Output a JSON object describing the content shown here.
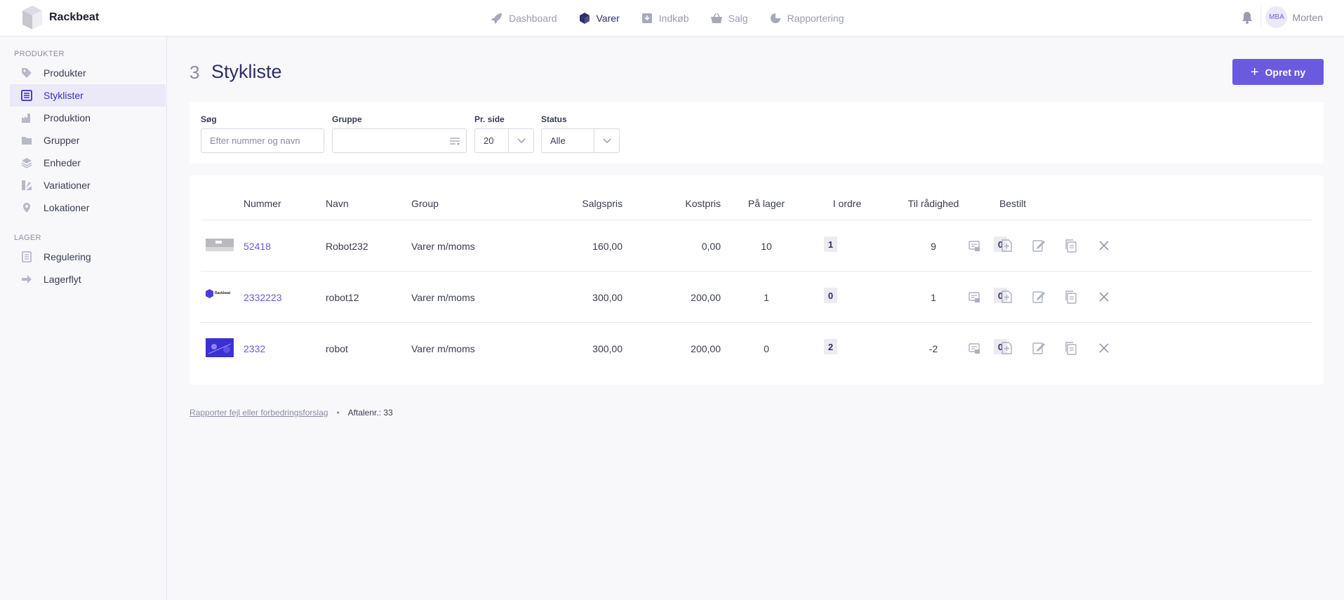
{
  "brand": {
    "name": "Rackbeat"
  },
  "topnav": [
    {
      "label": "Dashboard",
      "icon": "rocket-icon"
    },
    {
      "label": "Varer",
      "icon": "cube-icon"
    },
    {
      "label": "Indkøb",
      "icon": "download-box-icon"
    },
    {
      "label": "Salg",
      "icon": "basket-icon"
    },
    {
      "label": "Rapportering",
      "icon": "pie-chart-icon"
    }
  ],
  "user": {
    "initials": "MBA",
    "name": "Morten"
  },
  "sidebar": {
    "section_products": "PRODUKTER",
    "section_stock": "LAGER",
    "items": [
      {
        "label": "Produkter",
        "icon": "tag-icon"
      },
      {
        "label": "Styklister",
        "icon": "list-icon"
      },
      {
        "label": "Produktion",
        "icon": "factory-icon"
      },
      {
        "label": "Grupper",
        "icon": "folder-icon"
      },
      {
        "label": "Enheder",
        "icon": "layers-icon"
      },
      {
        "label": "Variationer",
        "icon": "variations-icon"
      },
      {
        "label": "Lokationer",
        "icon": "pin-icon"
      },
      {
        "label": "Regulering",
        "icon": "document-icon"
      },
      {
        "label": "Lagerflyt",
        "icon": "arrow-right-icon"
      }
    ]
  },
  "page": {
    "count": "3",
    "title": "Stykliste",
    "create_label": "Opret ny"
  },
  "filters": {
    "search_label": "Søg",
    "search_placeholder": "Efter nummer og navn",
    "group_label": "Gruppe",
    "group_value": "",
    "per_page_label": "Pr. side",
    "per_page_value": "20",
    "status_label": "Status",
    "status_value": "Alle"
  },
  "table": {
    "headers": [
      "Nummer",
      "Navn",
      "Group",
      "Salgspris",
      "Kostpris",
      "På lager",
      "I ordre",
      "Til rådighed",
      "Bestilt"
    ],
    "rows": [
      {
        "thumb": "grey",
        "number": "52418",
        "name": "Robot232",
        "group": "Varer m/moms",
        "price": "160,00",
        "cost": "0,00",
        "stock": "10",
        "in_order": "1",
        "available": "9",
        "ordered": "0"
      },
      {
        "thumb": "logo",
        "number": "2332223",
        "name": "robot12",
        "group": "Varer m/moms",
        "price": "300,00",
        "cost": "200,00",
        "stock": "1",
        "in_order": "0",
        "available": "1",
        "ordered": "0"
      },
      {
        "thumb": "blue",
        "number": "2332",
        "name": "robot",
        "group": "Varer m/moms",
        "price": "300,00",
        "cost": "200,00",
        "stock": "0",
        "in_order": "2",
        "available": "-2",
        "ordered": "0"
      }
    ],
    "logo_text": "Rackbeat"
  },
  "footer": {
    "report_link": "Rapporter fejl eller forbedringsforslag",
    "separator": "•",
    "agreement": "Aftalenr.: 33"
  },
  "colors": {
    "accent": "#6a5ae0",
    "title": "#2d2f6a",
    "sidebar_active_bg": "#ebe9f8"
  }
}
